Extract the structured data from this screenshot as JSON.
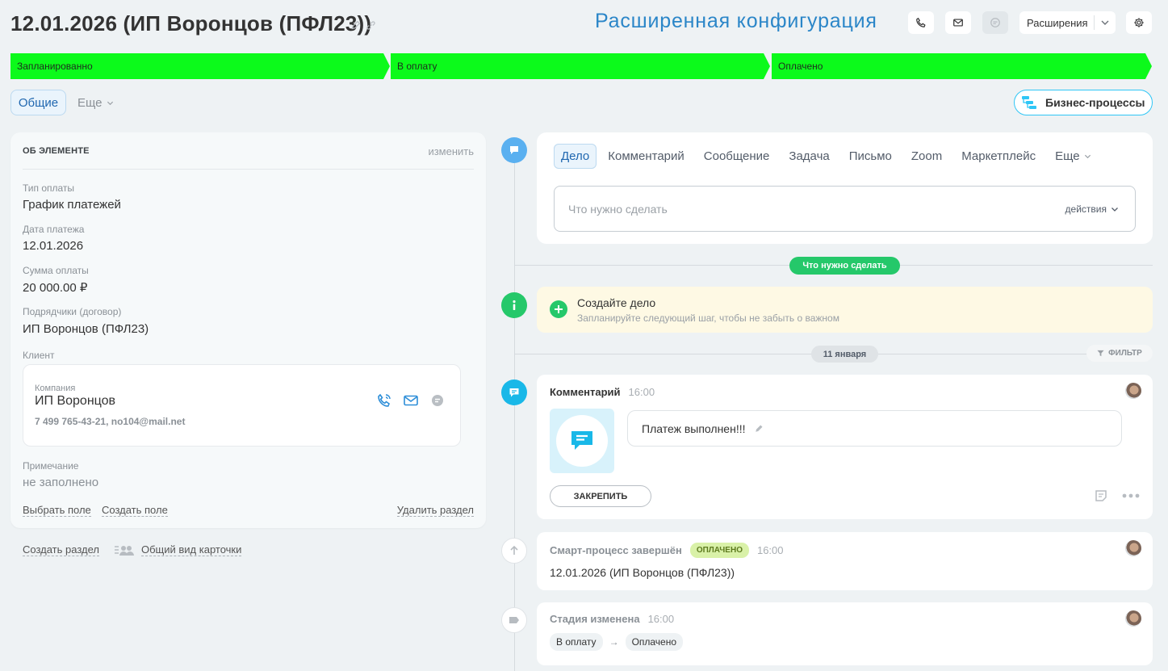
{
  "header": {
    "title": "12.01.2026 (ИП Воронцов (ПФЛ23))",
    "config_title": "Расширенная конфигурация",
    "extensions_label": "Расширения"
  },
  "stages": [
    {
      "label": "Запланированно"
    },
    {
      "label": "В оплату"
    },
    {
      "label": "Оплачено"
    }
  ],
  "tabs": {
    "general": "Общие",
    "more": "Еще",
    "business_processes": "Бизнес-процессы"
  },
  "element": {
    "heading": "ОБ ЭЛЕМЕНТЕ",
    "change": "изменить",
    "fields": [
      {
        "label": "Тип оплаты",
        "value": "График платежей"
      },
      {
        "label": "Дата платежа",
        "value": "12.01.2026"
      },
      {
        "label": "Сумма оплаты",
        "value": "20 000.00 ₽"
      },
      {
        "label": "Подрядчики (договор)",
        "value": "ИП Воронцов (ПФЛ23)"
      }
    ],
    "client_label": "Клиент",
    "client": {
      "type_label": "Компания",
      "name": "ИП Воронцов",
      "contacts": "7 499 765-43-21, no104@mail.net"
    },
    "note_label": "Примечание",
    "note_value": "не заполнено",
    "select_field": "Выбрать поле",
    "create_field": "Создать поле",
    "delete_section": "Удалить раздел"
  },
  "bottom": {
    "create_section": "Создать раздел",
    "card_view": "Общий вид карточки"
  },
  "editor": {
    "tabs": [
      "Дело",
      "Комментарий",
      "Сообщение",
      "Задача",
      "Письмо",
      "Zoom",
      "Маркетплейс"
    ],
    "more": "Еще",
    "placeholder": "Что нужно сделать",
    "actions": "действия"
  },
  "timeline": {
    "todo_pill": "Что нужно сделать",
    "todo_title": "Создайте дело",
    "todo_sub": "Запланируйте следующий шаг, чтобы не забыть о важном",
    "date_pill": "11 января",
    "filter": "ФИЛЬТР",
    "comment": {
      "title": "Комментарий",
      "time": "16:00",
      "text": "Платеж выполнен!!!",
      "pin": "ЗАКРЕПИТЬ"
    },
    "smart": {
      "title": "Смарт-процесс завершён",
      "badge": "ОПЛАЧЕНО",
      "time": "16:00",
      "text": "12.01.2026 (ИП Воронцов (ПФЛ23))"
    },
    "stage_change": {
      "title": "Стадия изменена",
      "time": "16:00",
      "from": "В оплату",
      "arrow": "→",
      "to": "Оплачено"
    }
  },
  "colors": {
    "stage": "#0cfa1b",
    "accent": "#2fc6f6",
    "brand_blue": "#2b86c8",
    "green": "#25c86a"
  }
}
